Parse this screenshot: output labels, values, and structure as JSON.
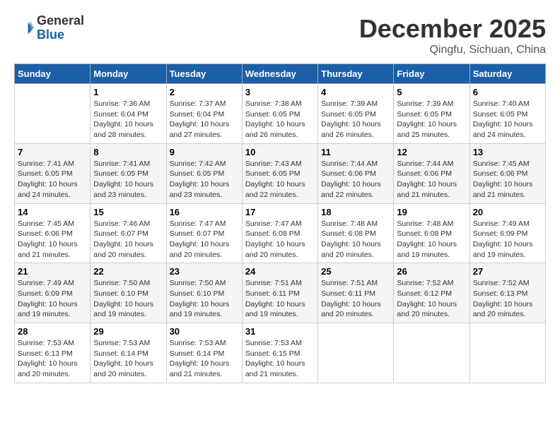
{
  "header": {
    "logo": {
      "general": "General",
      "blue": "Blue"
    },
    "title": "December 2025",
    "location": "Qingfu, Sichuan, China"
  },
  "weekdays": [
    "Sunday",
    "Monday",
    "Tuesday",
    "Wednesday",
    "Thursday",
    "Friday",
    "Saturday"
  ],
  "weeks": [
    [
      {
        "day": null,
        "info": ""
      },
      {
        "day": "1",
        "info": "Sunrise: 7:36 AM\nSunset: 6:04 PM\nDaylight: 10 hours\nand 28 minutes."
      },
      {
        "day": "2",
        "info": "Sunrise: 7:37 AM\nSunset: 6:04 PM\nDaylight: 10 hours\nand 27 minutes."
      },
      {
        "day": "3",
        "info": "Sunrise: 7:38 AM\nSunset: 6:05 PM\nDaylight: 10 hours\nand 26 minutes."
      },
      {
        "day": "4",
        "info": "Sunrise: 7:39 AM\nSunset: 6:05 PM\nDaylight: 10 hours\nand 26 minutes."
      },
      {
        "day": "5",
        "info": "Sunrise: 7:39 AM\nSunset: 6:05 PM\nDaylight: 10 hours\nand 25 minutes."
      },
      {
        "day": "6",
        "info": "Sunrise: 7:40 AM\nSunset: 6:05 PM\nDaylight: 10 hours\nand 24 minutes."
      }
    ],
    [
      {
        "day": "7",
        "info": "Sunrise: 7:41 AM\nSunset: 6:05 PM\nDaylight: 10 hours\nand 24 minutes."
      },
      {
        "day": "8",
        "info": "Sunrise: 7:41 AM\nSunset: 6:05 PM\nDaylight: 10 hours\nand 23 minutes."
      },
      {
        "day": "9",
        "info": "Sunrise: 7:42 AM\nSunset: 6:05 PM\nDaylight: 10 hours\nand 23 minutes."
      },
      {
        "day": "10",
        "info": "Sunrise: 7:43 AM\nSunset: 6:05 PM\nDaylight: 10 hours\nand 22 minutes."
      },
      {
        "day": "11",
        "info": "Sunrise: 7:44 AM\nSunset: 6:06 PM\nDaylight: 10 hours\nand 22 minutes."
      },
      {
        "day": "12",
        "info": "Sunrise: 7:44 AM\nSunset: 6:06 PM\nDaylight: 10 hours\nand 21 minutes."
      },
      {
        "day": "13",
        "info": "Sunrise: 7:45 AM\nSunset: 6:06 PM\nDaylight: 10 hours\nand 21 minutes."
      }
    ],
    [
      {
        "day": "14",
        "info": "Sunrise: 7:45 AM\nSunset: 6:06 PM\nDaylight: 10 hours\nand 21 minutes."
      },
      {
        "day": "15",
        "info": "Sunrise: 7:46 AM\nSunset: 6:07 PM\nDaylight: 10 hours\nand 20 minutes."
      },
      {
        "day": "16",
        "info": "Sunrise: 7:47 AM\nSunset: 6:07 PM\nDaylight: 10 hours\nand 20 minutes."
      },
      {
        "day": "17",
        "info": "Sunrise: 7:47 AM\nSunset: 6:08 PM\nDaylight: 10 hours\nand 20 minutes."
      },
      {
        "day": "18",
        "info": "Sunrise: 7:48 AM\nSunset: 6:08 PM\nDaylight: 10 hours\nand 20 minutes."
      },
      {
        "day": "19",
        "info": "Sunrise: 7:48 AM\nSunset: 6:08 PM\nDaylight: 10 hours\nand 19 minutes."
      },
      {
        "day": "20",
        "info": "Sunrise: 7:49 AM\nSunset: 6:09 PM\nDaylight: 10 hours\nand 19 minutes."
      }
    ],
    [
      {
        "day": "21",
        "info": "Sunrise: 7:49 AM\nSunset: 6:09 PM\nDaylight: 10 hours\nand 19 minutes."
      },
      {
        "day": "22",
        "info": "Sunrise: 7:50 AM\nSunset: 6:10 PM\nDaylight: 10 hours\nand 19 minutes."
      },
      {
        "day": "23",
        "info": "Sunrise: 7:50 AM\nSunset: 6:10 PM\nDaylight: 10 hours\nand 19 minutes."
      },
      {
        "day": "24",
        "info": "Sunrise: 7:51 AM\nSunset: 6:11 PM\nDaylight: 10 hours\nand 19 minutes."
      },
      {
        "day": "25",
        "info": "Sunrise: 7:51 AM\nSunset: 6:11 PM\nDaylight: 10 hours\nand 20 minutes."
      },
      {
        "day": "26",
        "info": "Sunrise: 7:52 AM\nSunset: 6:12 PM\nDaylight: 10 hours\nand 20 minutes."
      },
      {
        "day": "27",
        "info": "Sunrise: 7:52 AM\nSunset: 6:13 PM\nDaylight: 10 hours\nand 20 minutes."
      }
    ],
    [
      {
        "day": "28",
        "info": "Sunrise: 7:53 AM\nSunset: 6:13 PM\nDaylight: 10 hours\nand 20 minutes."
      },
      {
        "day": "29",
        "info": "Sunrise: 7:53 AM\nSunset: 6:14 PM\nDaylight: 10 hours\nand 20 minutes."
      },
      {
        "day": "30",
        "info": "Sunrise: 7:53 AM\nSunset: 6:14 PM\nDaylight: 10 hours\nand 21 minutes."
      },
      {
        "day": "31",
        "info": "Sunrise: 7:53 AM\nSunset: 6:15 PM\nDaylight: 10 hours\nand 21 minutes."
      },
      {
        "day": null,
        "info": ""
      },
      {
        "day": null,
        "info": ""
      },
      {
        "day": null,
        "info": ""
      }
    ]
  ]
}
